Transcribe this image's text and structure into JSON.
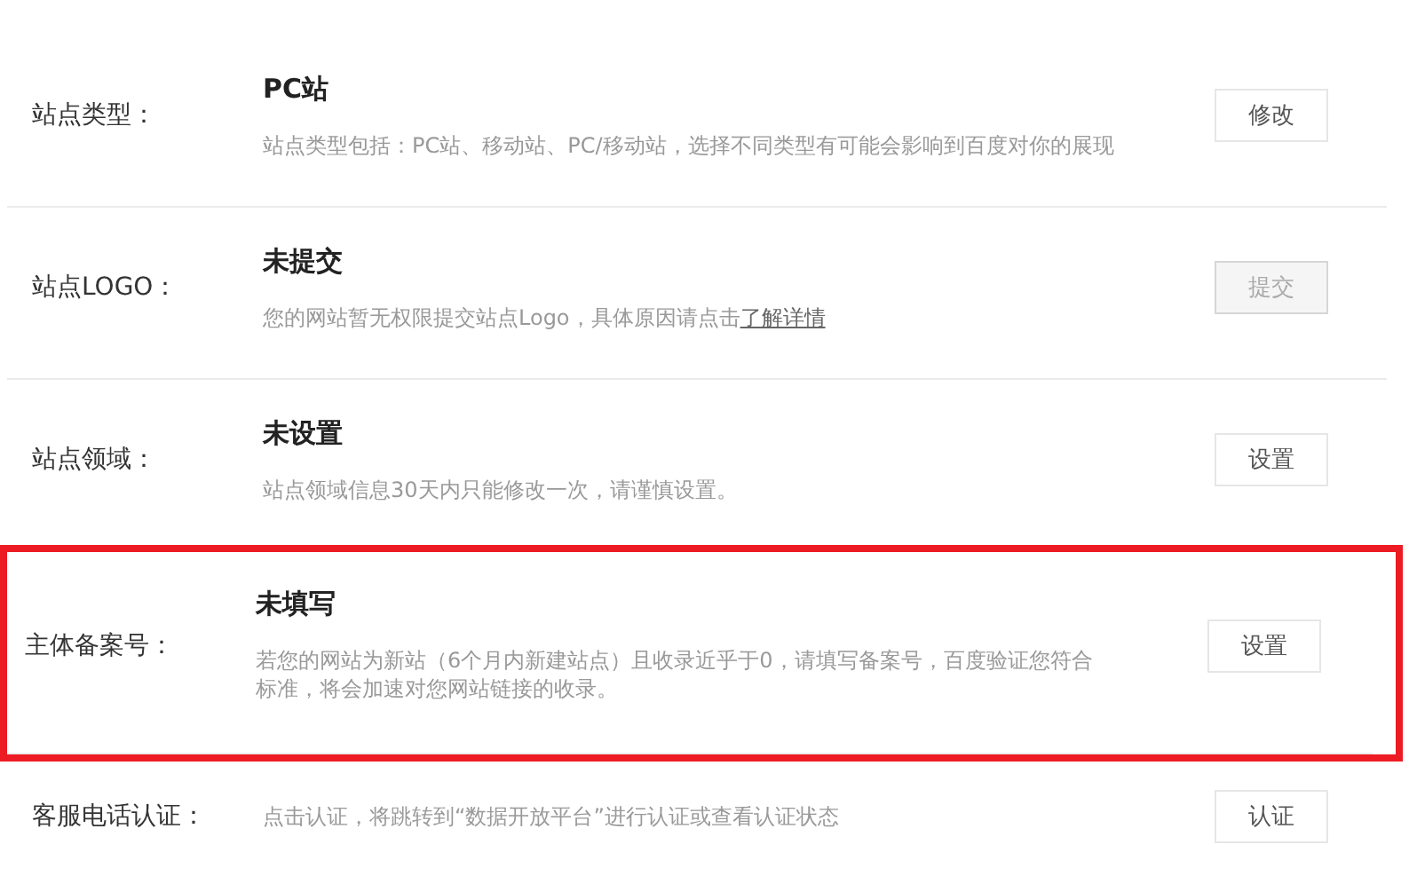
{
  "rows": [
    {
      "label": "站点类型：",
      "title": "PC站",
      "description": "站点类型包括：PC站、移动站、PC/移动站，选择不同类型有可能会影响到百度对你的展现",
      "button": {
        "label": "修改",
        "disabled": false
      },
      "highlighted": false
    },
    {
      "label": "站点LOGO：",
      "title": "未提交",
      "description": "您的网站暂无权限提交站点Logo，具体原因请点击",
      "link": "了解详情",
      "button": {
        "label": "提交",
        "disabled": true
      },
      "highlighted": false
    },
    {
      "label": "站点领域：",
      "title": "未设置",
      "description": "站点领域信息30天内只能修改一次，请谨慎设置。",
      "button": {
        "label": "设置",
        "disabled": false
      },
      "highlighted": false
    },
    {
      "label": "主体备案号：",
      "title": "未填写",
      "description": "若您的网站为新站（6个月内新建站点）且收录近乎于0，请填写备案号，百度验证您符合标准，将会加速对您网站链接的收录。",
      "button": {
        "label": "设置",
        "disabled": false
      },
      "highlighted": true
    },
    {
      "label": "客服电话认证：",
      "description": "点击认证，将跳转到“数据开放平台”进行认证或查看认证状态",
      "button": {
        "label": "认证",
        "disabled": false
      },
      "highlighted": false
    }
  ]
}
